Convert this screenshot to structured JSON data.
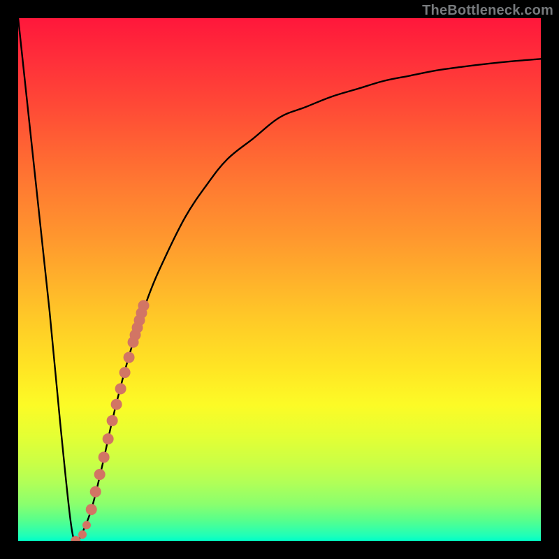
{
  "watermark": "TheBottleneck.com",
  "chart_data": {
    "type": "line",
    "title": "",
    "xlabel": "",
    "ylabel": "",
    "xlim": [
      0,
      100
    ],
    "ylim": [
      0,
      100
    ],
    "grid": false,
    "legend": false,
    "series": [
      {
        "name": "curve",
        "color": "#000000",
        "x": [
          0,
          3,
          6,
          8,
          10,
          11,
          12,
          14,
          16,
          18,
          20,
          22,
          25,
          28,
          32,
          36,
          40,
          45,
          50,
          55,
          60,
          65,
          70,
          75,
          80,
          85,
          90,
          95,
          100
        ],
        "y": [
          100,
          72,
          44,
          23,
          4,
          0,
          1,
          6,
          14,
          23,
          31,
          38,
          47,
          54,
          62,
          68,
          73,
          77,
          81,
          83,
          85,
          86.5,
          88,
          89,
          90,
          90.7,
          91.3,
          91.8,
          92.2
        ]
      }
    ],
    "markers": [
      {
        "name": "highlight-segment",
        "color": "#d27564",
        "shape": "circle",
        "radius_px": 8,
        "x": [
          14.0,
          14.8,
          15.6,
          16.4,
          17.2,
          18.0,
          18.8,
          19.6,
          20.4,
          21.2,
          22.0,
          22.4,
          22.8,
          23.2,
          23.6,
          24.0
        ],
        "y": [
          6.0,
          9.4,
          12.7,
          16.0,
          19.5,
          23.0,
          26.1,
          29.1,
          32.2,
          35.1,
          38.0,
          39.4,
          40.8,
          42.2,
          43.6,
          45.0
        ]
      },
      {
        "name": "dot-gap-1",
        "color": "#d27564",
        "shape": "circle",
        "radius_px": 6,
        "x": [
          13.1
        ],
        "y": [
          3.0
        ]
      },
      {
        "name": "dot-gap-2",
        "color": "#d27564",
        "shape": "circle",
        "radius_px": 6,
        "x": [
          12.3
        ],
        "y": [
          1.2
        ]
      },
      {
        "name": "dot-bottom",
        "color": "#d27564",
        "shape": "circle",
        "radius_px": 7,
        "x": [
          11.0
        ],
        "y": [
          0.0
        ]
      }
    ]
  }
}
